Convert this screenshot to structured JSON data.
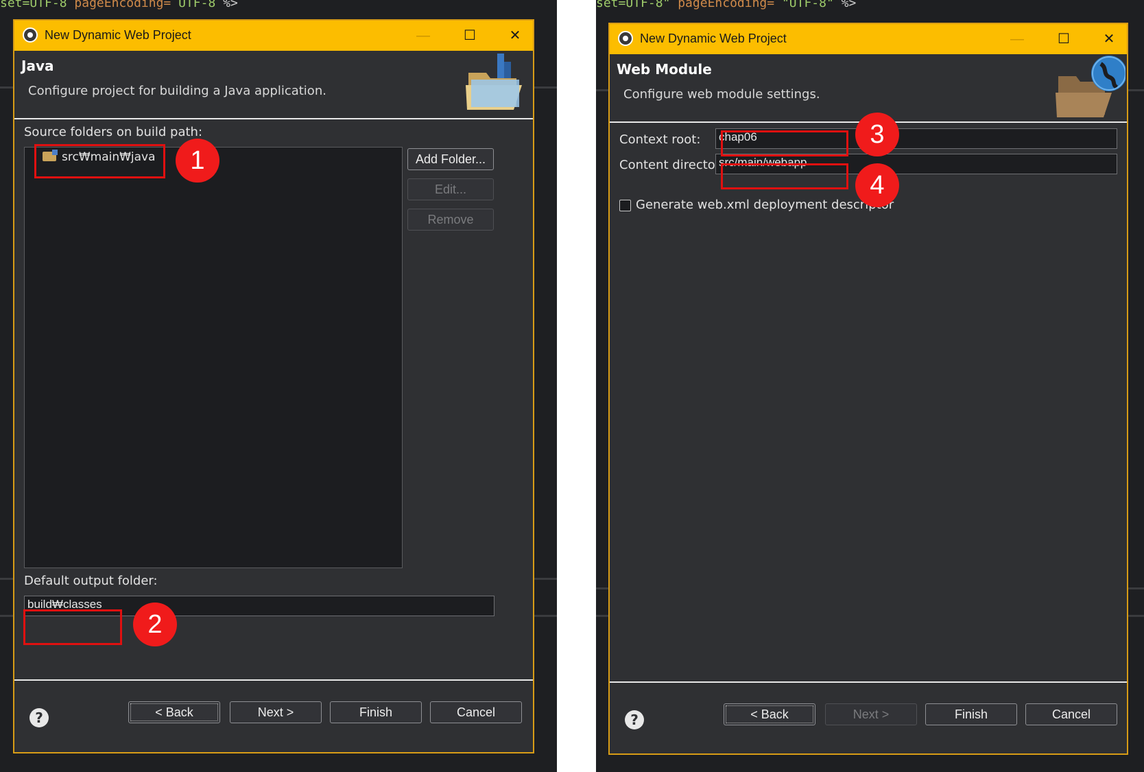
{
  "background_code": {
    "left_top": [
      "set=UTF-8",
      "pageEncoding=",
      "UTF-8",
      "%>"
    ],
    "right_top": [
      "set=UTF-8\"",
      "pageEncoding=",
      "\"UTF-8\"",
      "%>"
    ]
  },
  "left_dialog": {
    "window_title": "New Dynamic Web Project",
    "header_title": "Java",
    "header_description": "Configure project for building a Java application.",
    "source_folders_label": "Source folders on build path:",
    "source_folder_item": "src₩main₩java",
    "buttons": {
      "add_folder": "Add Folder...",
      "edit": "Edit...",
      "remove": "Remove"
    },
    "output_folder_label": "Default output folder:",
    "output_folder_value": "build₩classes",
    "footer": {
      "back": "< Back",
      "next": "Next >",
      "finish": "Finish",
      "cancel": "Cancel"
    }
  },
  "right_dialog": {
    "window_title": "New Dynamic Web Project",
    "header_title": "Web Module",
    "header_description": "Configure web module settings.",
    "context_root_label": "Context root:",
    "context_root_value": "chap06",
    "content_directory_label": "Content directory:",
    "content_directory_value": "src/main/webapp",
    "generate_webxml_label": "Generate web.xml deployment descriptor",
    "generate_webxml_checked": false,
    "footer": {
      "back": "< Back",
      "next": "Next >",
      "finish": "Finish",
      "cancel": "Cancel"
    }
  },
  "annotations": [
    "1",
    "2",
    "3",
    "4"
  ],
  "colors": {
    "titlebar": "#fcbd00",
    "dialog_bg": "#2f3033",
    "annotation_red": "#f01b1b"
  }
}
